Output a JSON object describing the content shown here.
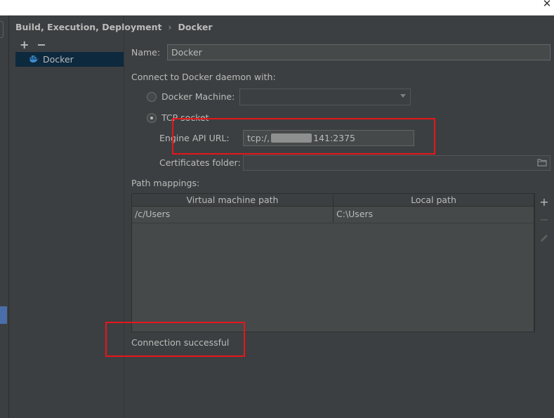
{
  "window": {
    "close_glyph": "✕"
  },
  "breadcrumb": {
    "parent": "Build, Execution, Deployment",
    "separator": "›",
    "current": "Docker"
  },
  "tree": {
    "add_label": "+",
    "remove_label": "−",
    "items": [
      {
        "label": "Docker",
        "icon": "docker-whale-icon"
      }
    ]
  },
  "form": {
    "name_label": "Name:",
    "name_value": "Docker",
    "connect_label": "Connect to Docker daemon with:",
    "docker_machine_label": "Docker Machine:",
    "docker_machine_value": "",
    "tcp_socket_label": "TCP socket",
    "engine_api_url_label": "Engine API URL:",
    "engine_api_url_prefix": "tcp:/,",
    "engine_api_url_suffix": "141:2375",
    "certificates_label": "Certificates folder:",
    "certificates_value": ""
  },
  "path_mappings": {
    "label": "Path mappings:",
    "columns": [
      "Virtual machine path",
      "Local path"
    ],
    "rows": [
      {
        "virtual": "/c/Users",
        "local": "C:\\Users"
      }
    ],
    "add_label": "+",
    "remove_label": "−"
  },
  "status": {
    "text": "Connection successful"
  },
  "colors": {
    "background": "#3c3f41",
    "selection": "#0d293e",
    "highlight_box": "#e8151b",
    "docker_icon": "#3d8fd1"
  }
}
